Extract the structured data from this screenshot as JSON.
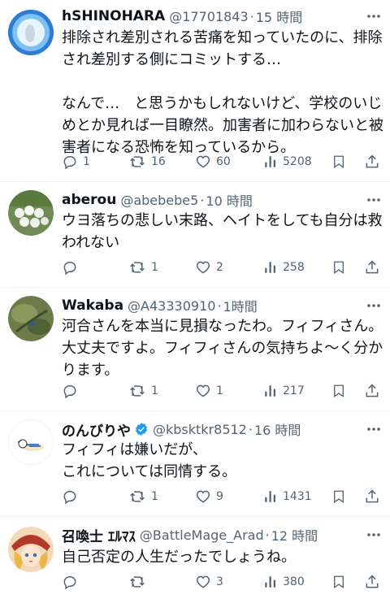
{
  "tweets": [
    {
      "name": "hSHINOHARA",
      "handle": "@17701843",
      "time": "15 時間",
      "lines": [
        "排除され差別される苦痛を知っていたのに、排除",
        "され差別する側にコミットする…",
        "",
        "なんで…　と思うかもしれないけど、学校のいじ",
        "めとか見れば一目瞭然。加害者に加わらないと被",
        "害者になる恐怖を知っているから。"
      ],
      "replies": "1",
      "retweets": "16",
      "likes": "60",
      "views": "5208"
    },
    {
      "name": "aberou",
      "handle": "@abebebe5",
      "time": "10 時間",
      "lines": [
        "ウヨ落ちの悲しい末路、ヘイトをしても自分は救",
        "われない"
      ],
      "replies": "",
      "retweets": "1",
      "likes": "2",
      "views": "258"
    },
    {
      "name": "Wakaba",
      "handle": "@A43330910",
      "time": "1時間",
      "lines": [
        "河合さんを本当に見損なったわ。フィフィさん。",
        "大丈夫ですよ。フィフィさんの気持ちよ～く分か",
        "ります。"
      ],
      "replies": "",
      "retweets": "1",
      "likes": "1",
      "views": "217"
    },
    {
      "name": "のんびりや",
      "handle": "@kbsktkr8512",
      "time": "16 時間",
      "lines": [
        "フィフィは嫌いだが、",
        "これについては同情する。"
      ],
      "replies": "",
      "retweets": "1",
      "likes": "9",
      "views": "1431"
    },
    {
      "name": "召喚士 ｴﾙﾏｽ",
      "handle": "@BattleMage_Arad",
      "time": "12 時間",
      "lines": [
        "自己否定の人生だったでしょうね。"
      ],
      "replies": "",
      "retweets": "",
      "likes": "3",
      "views": "380"
    }
  ],
  "colors": {
    "text": "#0f1419",
    "secondary": "#536471",
    "divider": "#eff3f4",
    "verified": "#1d9bf0"
  },
  "icons": [
    "reply-icon",
    "retweet-icon",
    "like-icon",
    "views-icon",
    "bookmark-icon",
    "share-icon",
    "more-icon",
    "verified-icon"
  ]
}
